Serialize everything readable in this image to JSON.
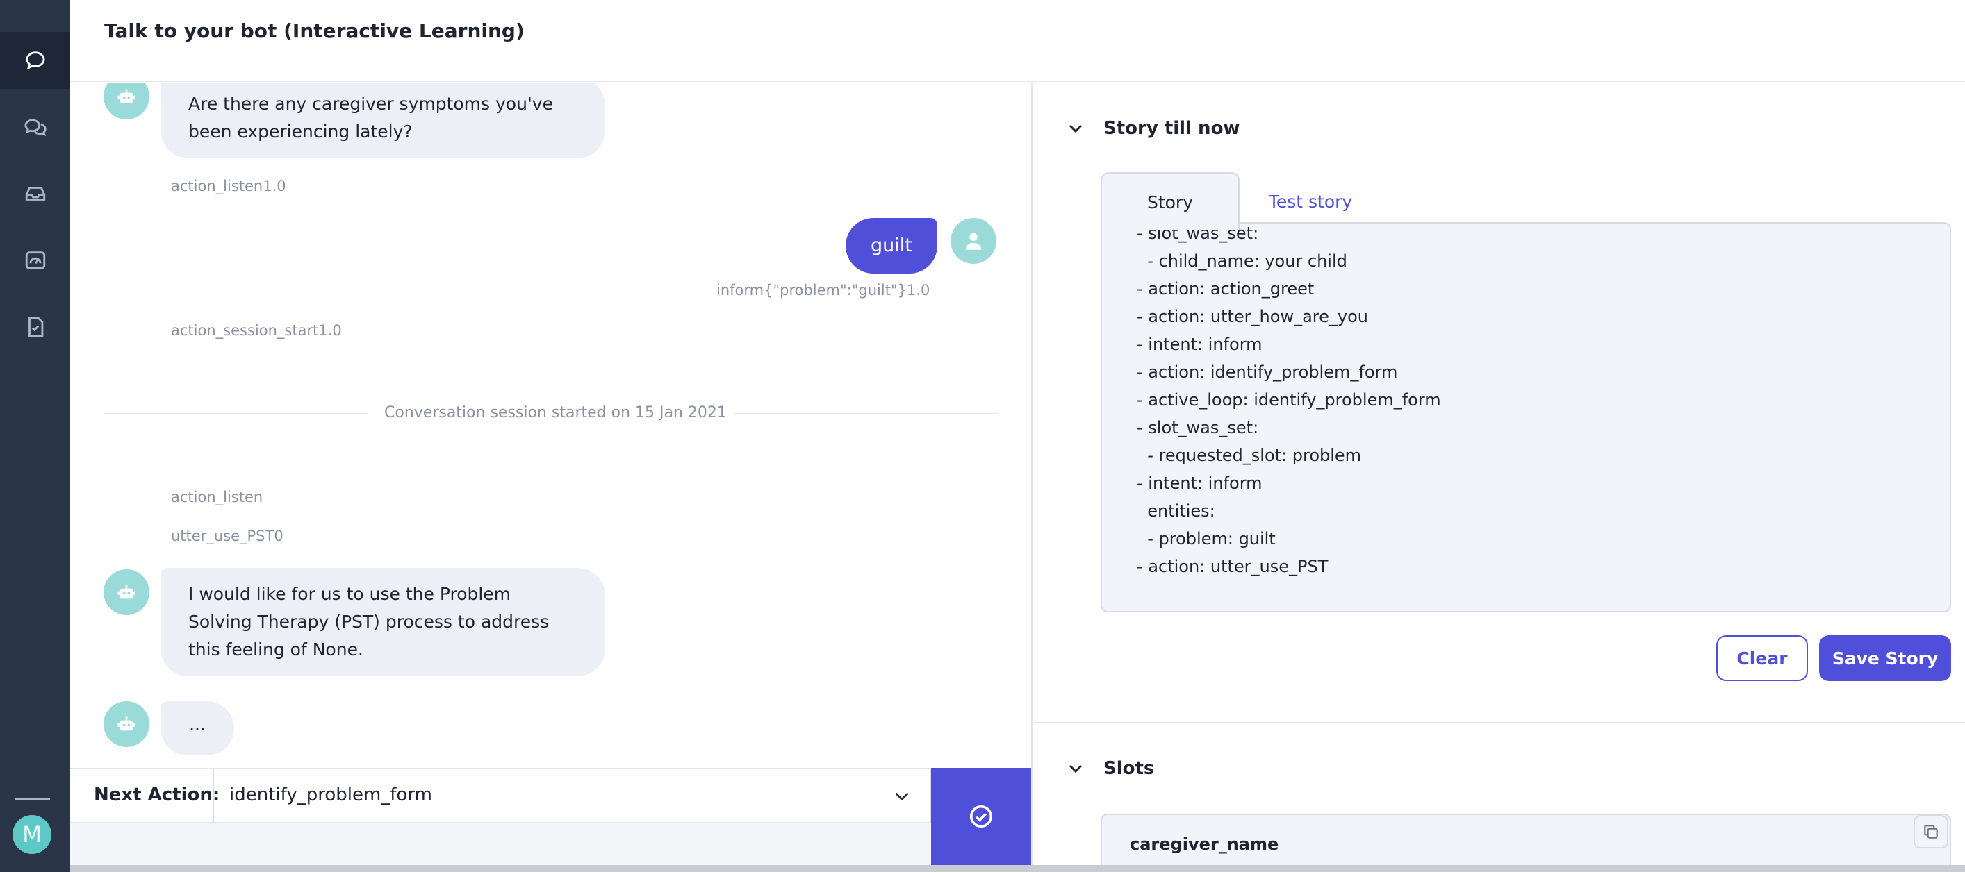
{
  "header": {
    "title": "Talk to your bot (Interactive Learning)"
  },
  "sidebar": {
    "items": [
      {
        "icon": "chat-bubble-icon",
        "active": true
      },
      {
        "icon": "conversations-icon",
        "active": false
      },
      {
        "icon": "inbox-icon",
        "active": false
      },
      {
        "icon": "dashboard-gauge-icon",
        "active": false
      },
      {
        "icon": "checklist-doc-icon",
        "active": false
      }
    ],
    "avatar_letter": "M"
  },
  "chat": {
    "messages": [
      {
        "type": "bot",
        "text": "Are there any caregiver symptoms you've been experiencing lately?"
      },
      {
        "type": "action",
        "text": "action_listen1.0"
      },
      {
        "type": "user",
        "text": "guilt"
      },
      {
        "type": "intent",
        "text": "inform{\"problem\":\"guilt\"}1.0"
      },
      {
        "type": "action",
        "text": "action_session_start1.0"
      },
      {
        "type": "session",
        "text": "Conversation session started on 15 Jan 2021"
      },
      {
        "type": "action",
        "text": "action_listen"
      },
      {
        "type": "action",
        "text": "utter_use_PST0"
      },
      {
        "type": "bot",
        "text": "I would like for us to use the Problem Solving Therapy (PST) process to address this feeling of None."
      },
      {
        "type": "bot",
        "text": "..."
      }
    ]
  },
  "next_action": {
    "label": "Next Action:",
    "selected": "identify_problem_form"
  },
  "story_panel": {
    "title": "Story till now",
    "tabs": [
      "Story",
      "Test story"
    ],
    "active_tab": "Story",
    "story_lines": [
      "- slot_was_set:",
      "  - child_name: your child",
      "- action: action_greet",
      "- action: utter_how_are_you",
      "- intent: inform",
      "- action: identify_problem_form",
      "- active_loop: identify_problem_form",
      "- slot_was_set:",
      "  - requested_slot: problem",
      "- intent: inform",
      "  entities:",
      "  - problem: guilt",
      "- action: utter_use_PST"
    ],
    "clear_label": "Clear",
    "save_label": "Save Story"
  },
  "slots_panel": {
    "title": "Slots",
    "first_slot": "caregiver_name"
  },
  "colors": {
    "accent": "#4f4fd9",
    "sidebar": "#2b3548",
    "bubble_bot": "#eceff6",
    "avatar": "#9adbd9"
  }
}
